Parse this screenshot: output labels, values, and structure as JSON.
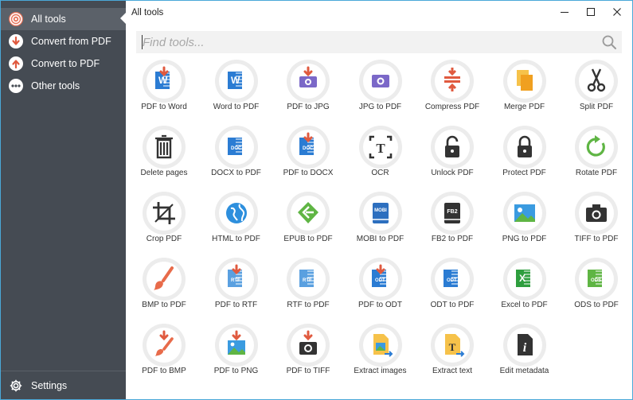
{
  "window": {
    "title": "All tools"
  },
  "sidebar": {
    "items": [
      {
        "label": "All tools",
        "icon": "all-tools-icon",
        "active": true
      },
      {
        "label": "Convert from PDF",
        "icon": "arrow-down-icon",
        "active": false
      },
      {
        "label": "Convert to PDF",
        "icon": "arrow-up-icon",
        "active": false
      },
      {
        "label": "Other tools",
        "icon": "more-dots-icon",
        "active": false
      }
    ],
    "settings_label": "Settings"
  },
  "search": {
    "placeholder": "Find tools...",
    "value": ""
  },
  "colors": {
    "sidebar_bg": "#454b53",
    "sidebar_active": "#5b6169",
    "accent_red": "#e05a3f",
    "word_blue": "#2b7cd3",
    "pdf_orange": "#f0a020",
    "excel_green": "#2e9e3e"
  },
  "tools": [
    {
      "label": "PDF to Word",
      "icon": "pdf-to-word-icon"
    },
    {
      "label": "Word to PDF",
      "icon": "word-to-pdf-icon"
    },
    {
      "label": "PDF to JPG",
      "icon": "pdf-to-jpg-icon"
    },
    {
      "label": "JPG to PDF",
      "icon": "jpg-to-pdf-icon"
    },
    {
      "label": "Compress PDF",
      "icon": "compress-pdf-icon"
    },
    {
      "label": "Merge PDF",
      "icon": "merge-pdf-icon"
    },
    {
      "label": "Split PDF",
      "icon": "scissors-icon"
    },
    {
      "label": "Delete pages",
      "icon": "trash-icon"
    },
    {
      "label": "DOCX to PDF",
      "icon": "docx-to-pdf-icon"
    },
    {
      "label": "PDF to DOCX",
      "icon": "pdf-to-docx-icon"
    },
    {
      "label": "OCR",
      "icon": "ocr-icon"
    },
    {
      "label": "Unlock PDF",
      "icon": "unlock-icon"
    },
    {
      "label": "Protect PDF",
      "icon": "lock-icon"
    },
    {
      "label": "Rotate PDF",
      "icon": "rotate-icon"
    },
    {
      "label": "Crop PDF",
      "icon": "crop-icon"
    },
    {
      "label": "HTML to PDF",
      "icon": "globe-icon"
    },
    {
      "label": "EPUB to PDF",
      "icon": "epub-icon"
    },
    {
      "label": "MOBI to PDF",
      "icon": "mobi-icon"
    },
    {
      "label": "FB2 to PDF",
      "icon": "fb2-icon"
    },
    {
      "label": "PNG to PDF",
      "icon": "png-to-pdf-icon"
    },
    {
      "label": "TIFF to PDF",
      "icon": "camera-icon"
    },
    {
      "label": "BMP to PDF",
      "icon": "brush-icon"
    },
    {
      "label": "PDF to RTF",
      "icon": "pdf-to-rtf-icon"
    },
    {
      "label": "RTF to PDF",
      "icon": "rtf-to-pdf-icon"
    },
    {
      "label": "PDF to ODT",
      "icon": "pdf-to-odt-icon"
    },
    {
      "label": "ODT to PDF",
      "icon": "odt-to-pdf-icon"
    },
    {
      "label": "Excel to PDF",
      "icon": "excel-to-pdf-icon"
    },
    {
      "label": "ODS to PDF",
      "icon": "ods-to-pdf-icon"
    },
    {
      "label": "PDF to BMP",
      "icon": "pdf-to-bmp-icon"
    },
    {
      "label": "PDF to PNG",
      "icon": "pdf-to-png-icon"
    },
    {
      "label": "PDF to TIFF",
      "icon": "pdf-to-tiff-icon"
    },
    {
      "label": "Extract images",
      "icon": "extract-images-icon"
    },
    {
      "label": "Extract text",
      "icon": "extract-text-icon"
    },
    {
      "label": "Edit metadata",
      "icon": "metadata-icon"
    }
  ],
  "icon_text": {
    "word_letter": "W",
    "docx_tag": "DOCX",
    "ocr_letter": "T",
    "mobi_tag": "MOBI",
    "fb2_tag": "FB2",
    "rtf_tag": "RTF",
    "odt_tag": "ODT",
    "excel_letter": "X",
    "ods_tag": "ODS",
    "text_letter": "T",
    "info_letter": "i"
  }
}
